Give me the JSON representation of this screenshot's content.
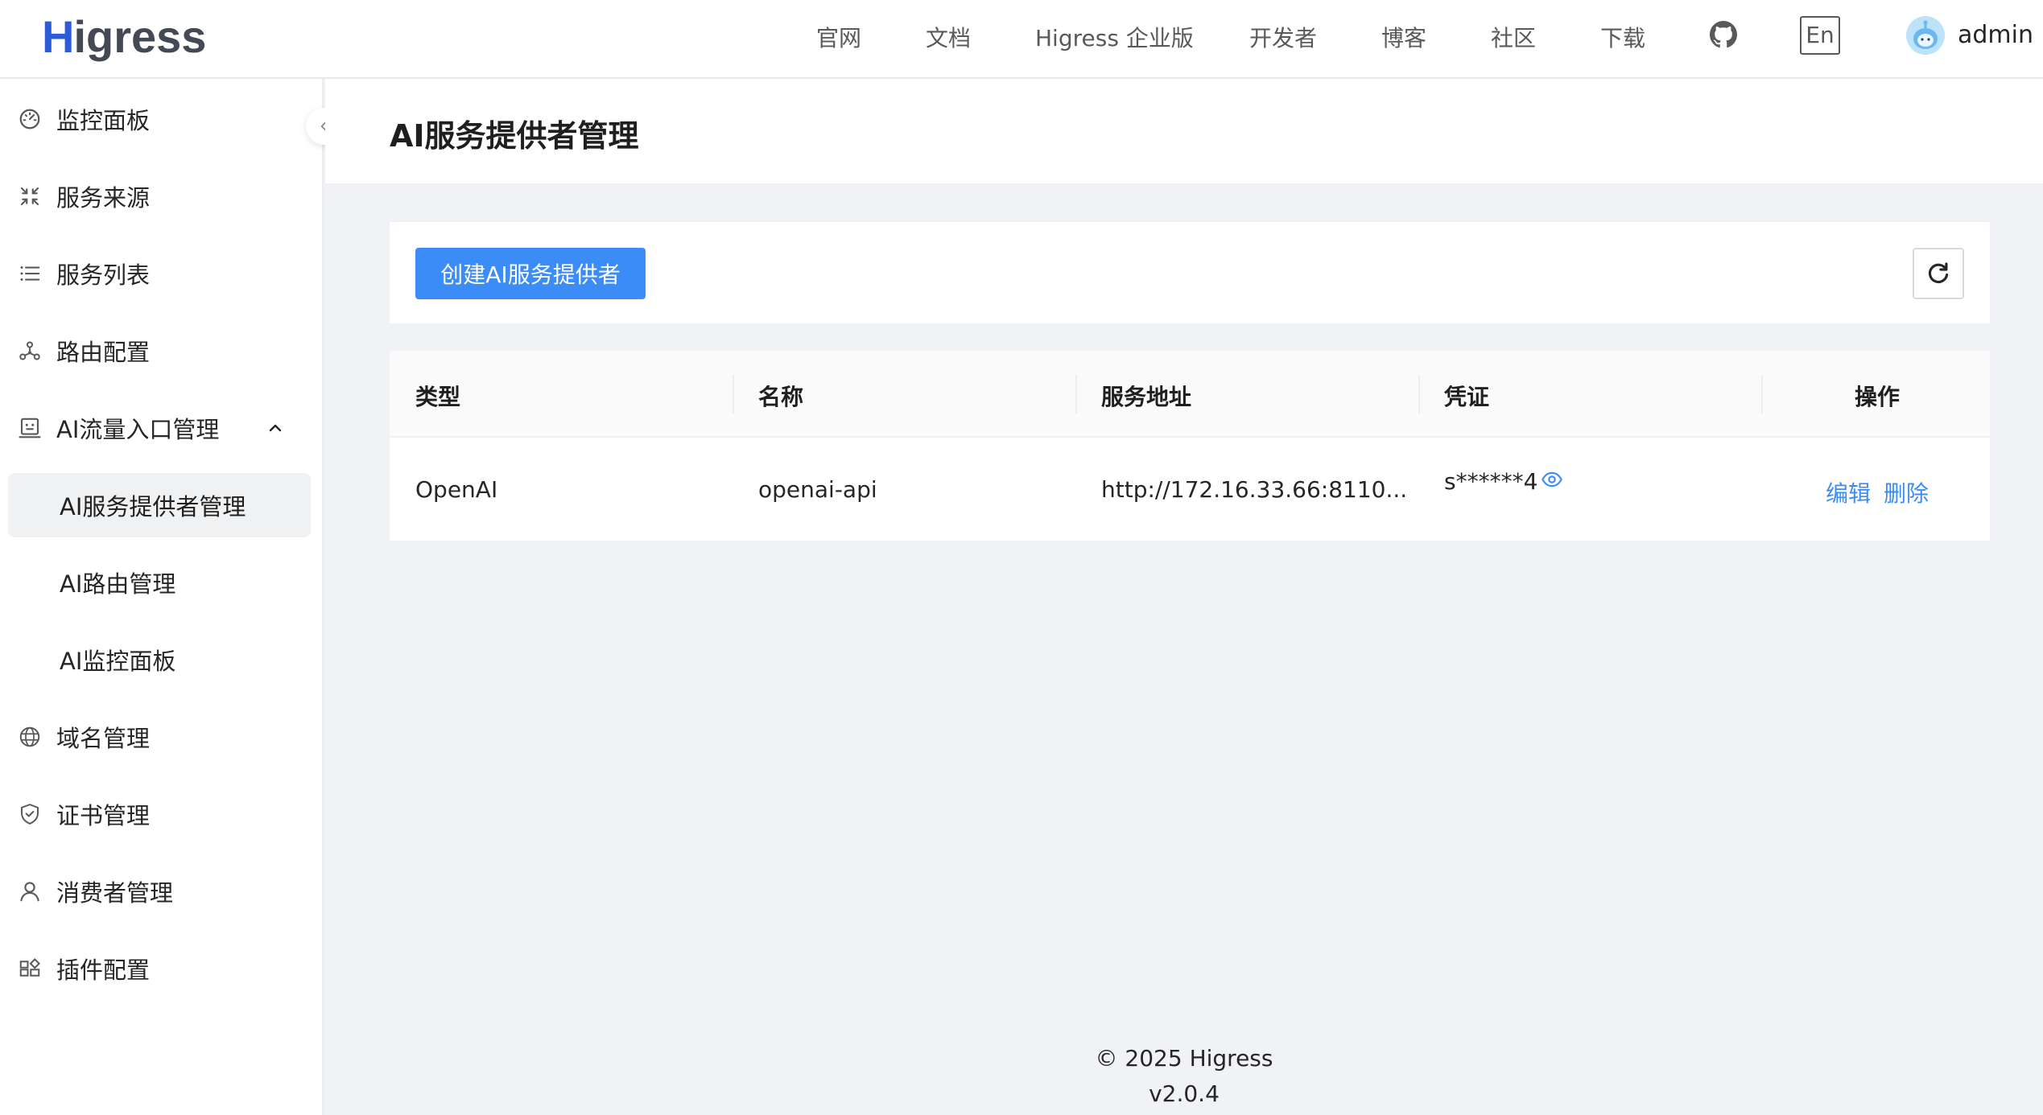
{
  "header": {
    "logo_first": "H",
    "logo_rest": "igress",
    "nav": [
      "官网",
      "文档",
      "Higress 企业版",
      "开发者",
      "博客",
      "社区",
      "下载"
    ],
    "lang_button": "En",
    "username": "admin"
  },
  "sidebar": {
    "items": [
      {
        "label": "监控面板",
        "icon": "dashboard-icon"
      },
      {
        "label": "服务来源",
        "icon": "compress-arrows-icon"
      },
      {
        "label": "服务列表",
        "icon": "list-icon"
      },
      {
        "label": "路由配置",
        "icon": "route-nodes-icon"
      },
      {
        "label": "AI流量入口管理",
        "icon": "robot-icon",
        "expanded": true
      },
      {
        "label": "AI服务提供者管理",
        "sub": true,
        "active": true
      },
      {
        "label": "AI路由管理",
        "sub": true
      },
      {
        "label": "AI监控面板",
        "sub": true
      },
      {
        "label": "域名管理",
        "icon": "globe-icon"
      },
      {
        "label": "证书管理",
        "icon": "shield-check-icon"
      },
      {
        "label": "消费者管理",
        "icon": "user-icon"
      },
      {
        "label": "插件配置",
        "icon": "plugin-grid-icon"
      }
    ]
  },
  "page": {
    "title": "AI服务提供者管理",
    "create_button": "创建AI服务提供者"
  },
  "table": {
    "columns": [
      "类型",
      "名称",
      "服务地址",
      "凭证",
      "操作"
    ],
    "rows": [
      {
        "type": "OpenAI",
        "name": "openai-api",
        "address": "http://172.16.33.66:8110...",
        "credential": "s******4",
        "actions": [
          "编辑",
          "删除"
        ]
      }
    ]
  },
  "footer": {
    "copyright": "© 2025 Higress",
    "version": "v2.0.4"
  },
  "colors": {
    "primary": "#3b8cf7",
    "logo_blue": "#2d5bd7",
    "background": "#f0f2f5"
  }
}
